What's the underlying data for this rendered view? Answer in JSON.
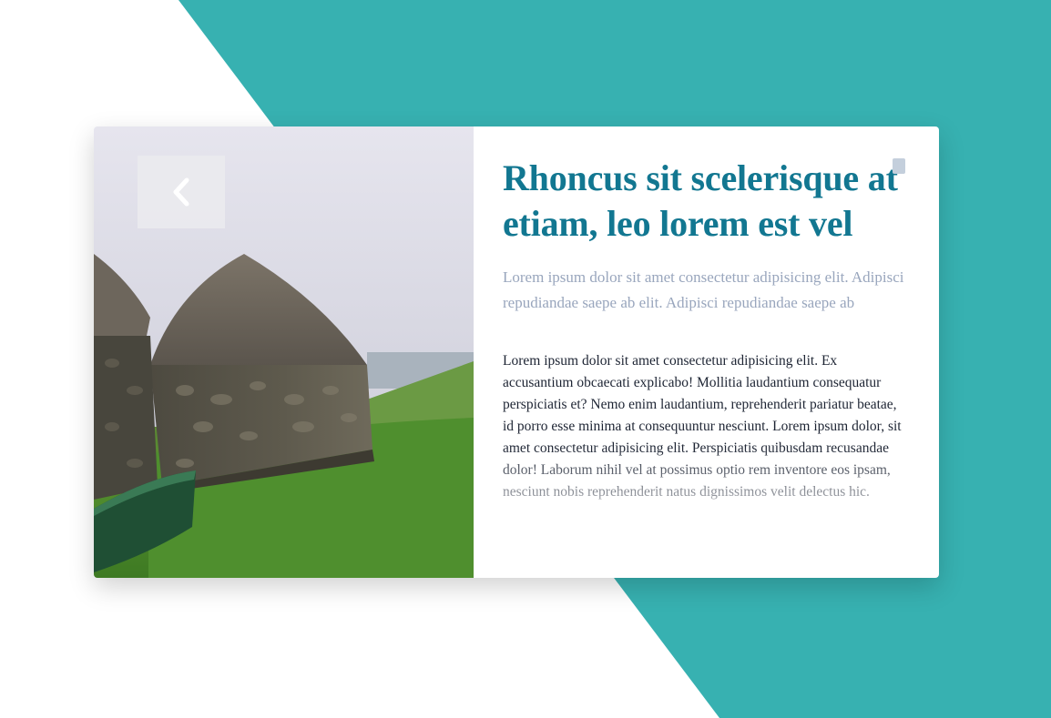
{
  "colors": {
    "accent": "#37b1b1",
    "title": "#127791",
    "subtitle": "#99a6bd",
    "body": "#1d2433"
  },
  "icons": {
    "prev": "chevron-left-icon"
  },
  "card": {
    "title": "Rhoncus sit scelerisque at etiam, leo lorem est vel",
    "subtitle": "Lorem ipsum dolor sit amet consectetur adipisicing elit. Adipisci repudiandae saepe ab elit. Adipisci repudiandae saepe ab",
    "body": "Lorem ipsum dolor sit amet consectetur adipisicing elit. Ex accusantium obcaecati explicabo! Mollitia laudantium consequatur perspiciatis et? Nemo enim laudantium, reprehenderit pariatur beatae, id porro esse minima at consequuntur nesciunt. Lorem ipsum dolor, sit amet consectetur adipisicing elit. Perspiciatis quibusdam recusandae dolor! Laborum nihil vel at possimus optio rem inventore eos ipsam, nesciunt nobis reprehenderit natus dignissimos velit delectus hic."
  }
}
